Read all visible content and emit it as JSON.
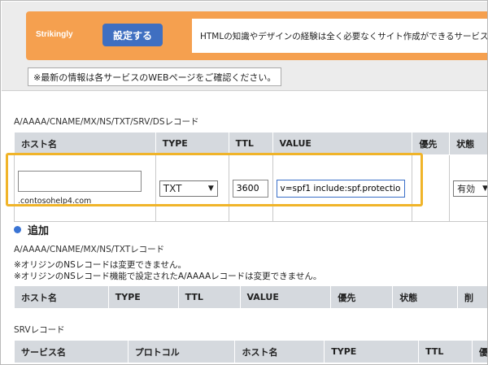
{
  "banner": {
    "brand": "Strikingly",
    "button_label": "設定する",
    "description": "HTMLの知識やデザインの経験は全く必要なくサイト作成ができるサービス"
  },
  "notice": "※最新の情報は各サービスのWEBページをご確認ください。",
  "record_section": {
    "label": "A/AAAA/CNAME/MX/NS/TXT/SRV/DSレコード",
    "columns": [
      "ホスト名",
      "TYPE",
      "TTL",
      "VALUE",
      "優先",
      "状態"
    ],
    "row": {
      "host_value": "",
      "domain_suffix": ".contosohelp4.com",
      "type": "TXT",
      "ttl": "3600",
      "value": "v=spf1 include:spf.protectio",
      "priority": "",
      "status": "有効"
    }
  },
  "add_section": {
    "title": "追加",
    "label": "A/AAAA/CNAME/MX/NS/TXTレコード",
    "notes": [
      "※オリジンのNSレコードは変更できません。",
      "※オリジンのNSレコード機能で設定されたA/AAAAレコードは変更できません。"
    ],
    "columns": [
      "ホスト名",
      "TYPE",
      "TTL",
      "VALUE",
      "優先",
      "状態",
      "削"
    ]
  },
  "srv_section": {
    "label": "SRVレコード",
    "columns": [
      "サービス名",
      "プロトコル",
      "ホスト名",
      "TYPE",
      "TTL",
      "優"
    ]
  },
  "colors": {
    "banner": "#f5a04f",
    "button": "#3f6fc1",
    "highlight": "#f0b429",
    "header_cell": "#d5d9de"
  }
}
